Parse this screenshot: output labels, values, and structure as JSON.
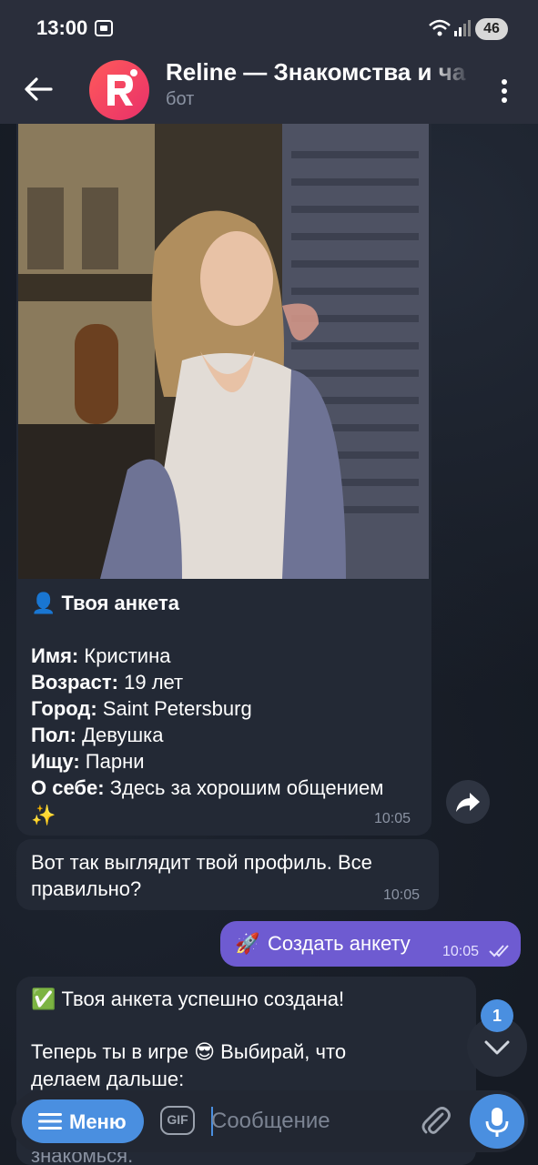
{
  "status_bar": {
    "time": "13:00",
    "battery": "46"
  },
  "header": {
    "title": "Reline — Знакомства и ча",
    "subtitle": "бот"
  },
  "messages": {
    "profile": {
      "heading_icon": "👤",
      "heading": "Твоя анкета",
      "fields": [
        {
          "label": "Имя:",
          "value": "Кристина"
        },
        {
          "label": "Возраст:",
          "value": "19 лет"
        },
        {
          "label": "Город:",
          "value": "Saint Petersburg"
        },
        {
          "label": "Пол:",
          "value": "Девушка"
        },
        {
          "label": "Ищу:",
          "value": "Парни"
        },
        {
          "label": "О себе:",
          "value": "Здесь за хорошим общением"
        }
      ],
      "about_emoji": "✨",
      "time": "10:05"
    },
    "confirm": {
      "text_line1": "Вот так выглядит твой профиль. Все",
      "text_line2": "правильно?",
      "time": "10:05"
    },
    "outgoing": {
      "emoji": "🚀",
      "text": "Создать анкету",
      "time": "10:05"
    },
    "created": {
      "line1_emoji": "✅",
      "line1": "Твоя анкета успешно создана!",
      "line2_part1": "Теперь ты в игре",
      "line2_emoji": "😎",
      "line2_part2": "Выбирай, что",
      "line3": "делаем дальше:",
      "line4": "знакомься."
    }
  },
  "scroll": {
    "unread_count": "1"
  },
  "composer": {
    "menu_label": "Меню",
    "gif_label": "GIF",
    "placeholder": "Сообщение"
  },
  "colors": {
    "accent": "#4a8fe0",
    "outgoing_bubble": "#6e5bd1",
    "incoming_bubble": "#232935",
    "header_bg": "#2a2e3b"
  }
}
